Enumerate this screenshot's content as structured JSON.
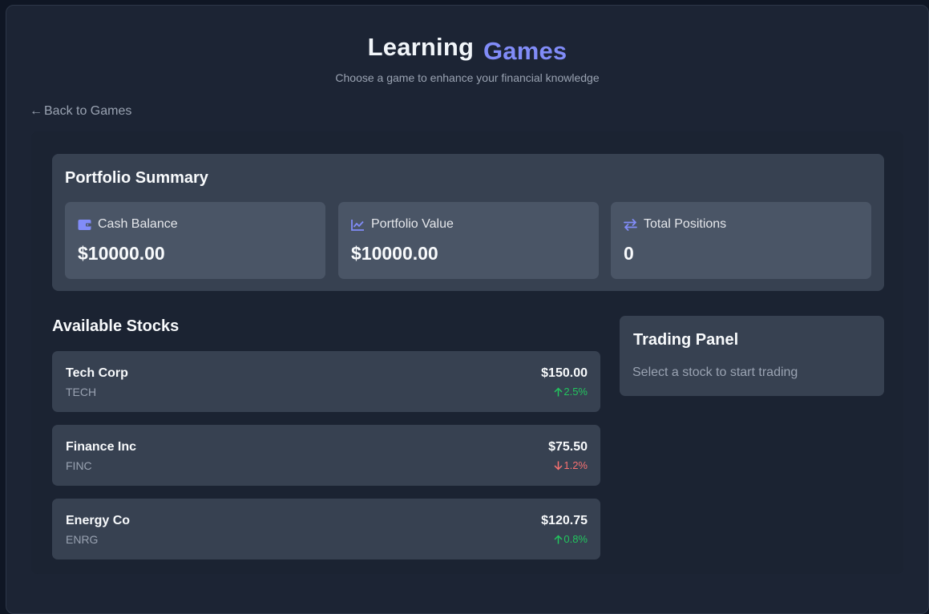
{
  "header": {
    "title_main": "Learning",
    "title_accent": "Games",
    "subtitle": "Choose a game to enhance your financial knowledge"
  },
  "nav": {
    "back_arrow": "←",
    "back_label": "Back to Games"
  },
  "summary": {
    "title": "Portfolio Summary",
    "stats": [
      {
        "label": "Cash Balance",
        "value": "$10000.00",
        "icon": "wallet-icon"
      },
      {
        "label": "Portfolio Value",
        "value": "$10000.00",
        "icon": "chart-line-icon"
      },
      {
        "label": "Total Positions",
        "value": "0",
        "icon": "swap-arrows-icon"
      }
    ]
  },
  "stocks": {
    "title": "Available Stocks",
    "items": [
      {
        "name": "Tech Corp",
        "symbol": "TECH",
        "price": "$150.00",
        "change": "2.5%",
        "direction": "up"
      },
      {
        "name": "Finance Inc",
        "symbol": "FINC",
        "price": "$75.50",
        "change": "1.2%",
        "direction": "down"
      },
      {
        "name": "Energy Co",
        "symbol": "ENRG",
        "price": "$120.75",
        "change": "0.8%",
        "direction": "up"
      }
    ]
  },
  "trading_panel": {
    "title": "Trading Panel",
    "placeholder": "Select a stock to start trading"
  },
  "colors": {
    "accent": "#818cf8",
    "up": "#22c55e",
    "down": "#f87171"
  }
}
